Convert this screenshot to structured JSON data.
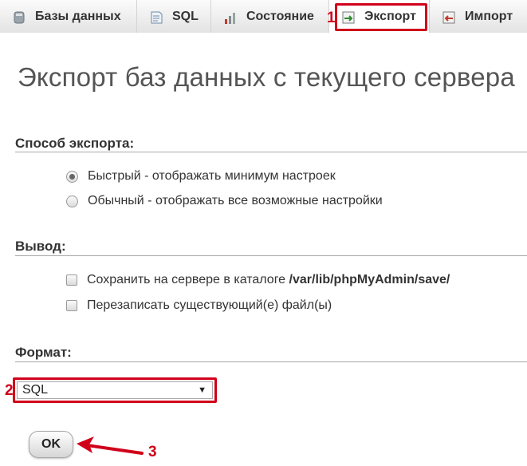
{
  "tabs": [
    {
      "label": "Базы данных",
      "icon": "database-icon"
    },
    {
      "label": "SQL",
      "icon": "sql-icon"
    },
    {
      "label": "Состояние",
      "icon": "status-icon"
    },
    {
      "label": "Экспорт",
      "icon": "export-icon",
      "active": true
    },
    {
      "label": "Импорт",
      "icon": "import-icon"
    }
  ],
  "annotations": {
    "n1": "1",
    "n2": "2",
    "n3": "3",
    "color": "#d0001a"
  },
  "page_title": "Экспорт баз данных с текущего сервера",
  "export_method": {
    "title": "Способ экспорта:",
    "options": [
      {
        "label": "Быстрый - отображать минимум настроек",
        "checked": true
      },
      {
        "label": "Обычный - отображать все возможные настройки",
        "checked": false
      }
    ]
  },
  "output": {
    "title": "Вывод:",
    "save_prefix": "Сохранить на сервере в каталоге ",
    "save_path": "/var/lib/phpMyAdmin/save/",
    "overwrite_label": "Перезаписать существующий(е) файл(ы)"
  },
  "format": {
    "title": "Формат:",
    "selected": "SQL"
  },
  "ok_label": "OK"
}
